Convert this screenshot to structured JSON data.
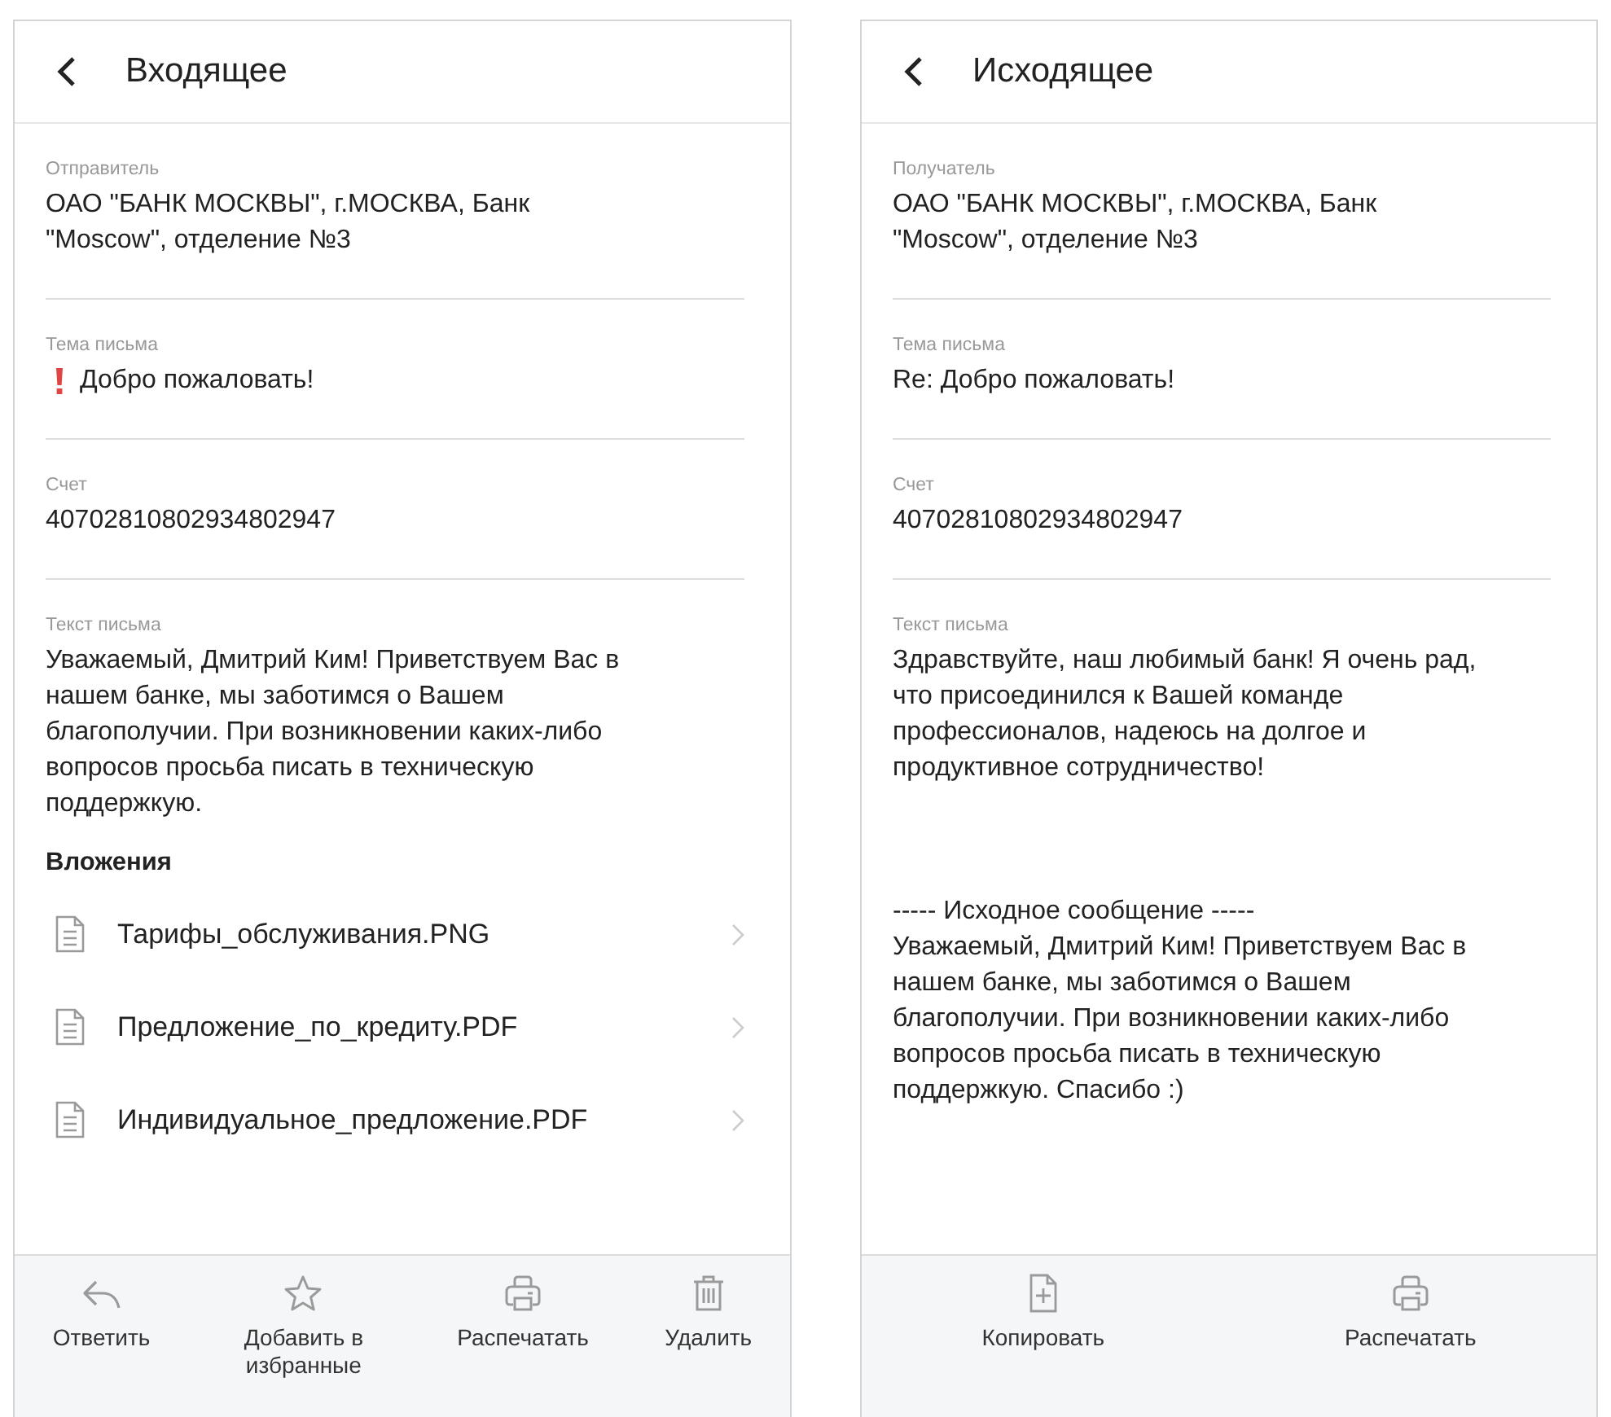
{
  "screens": [
    {
      "title": "Входящее",
      "fields": [
        {
          "kind": "text",
          "label": "Отправитель",
          "value": "ОАО \"БАНК МОСКВЫ\", г.МОСКВА, Банк \"Moscow\", отделение №3"
        },
        {
          "kind": "subject",
          "label": "Тема письма",
          "value": "Добро пожаловать!",
          "important": true
        },
        {
          "kind": "text",
          "label": "Счет",
          "value": "40702810802934802947"
        }
      ],
      "message": {
        "label": "Текст письма",
        "text": "Уважаемый, Дмитрий Ким! Приветствуем Вас в нашем банке, мы заботимся о Вашем благополучии. При возникновении каких-либо вопросов просьба писать в техническую поддержкую."
      },
      "attachments_title": "Вложения",
      "attachments": [
        "Тарифы_обслуживания.PNG",
        "Предложение_по_кредиту.PDF",
        "Индивидуальное_предложение.PDF"
      ],
      "actions": [
        {
          "kind": "reply",
          "label": "Ответить"
        },
        {
          "kind": "favorite",
          "label": "Добавить в избранные"
        },
        {
          "kind": "print",
          "label": "Распечатать"
        },
        {
          "kind": "delete",
          "label": "Удалить"
        }
      ]
    },
    {
      "title": "Исходящее",
      "fields": [
        {
          "kind": "text",
          "label": "Получатель",
          "value": "ОАО \"БАНК МОСКВЫ\", г.МОСКВА, Банк \"Moscow\", отделение №3"
        },
        {
          "kind": "subject",
          "label": "Тема письма",
          "value": "Re: Добро пожаловать!",
          "important": false
        },
        {
          "kind": "text",
          "label": "Счет",
          "value": "40702810802934802947"
        }
      ],
      "message": {
        "label": "Текст письма",
        "text": "Здравствуйте, наш любимый банк! Я очень рад, что присоединился к Вашей команде профессионалов, надеюсь на долгое и продуктивное сотрудничество!",
        "quote_header": "----- Исходное сообщение -----",
        "quote_text": "Уважаемый, Дмитрий Ким! Приветствуем Вас в нашем банке, мы заботимся о Вашем благополучии. При возникновении каких-либо вопросов просьба писать в техническую поддержкую. Спасибо :)"
      },
      "actions": [
        {
          "kind": "copy",
          "label": "Копировать"
        },
        {
          "kind": "print",
          "label": "Распечатать"
        }
      ]
    }
  ]
}
